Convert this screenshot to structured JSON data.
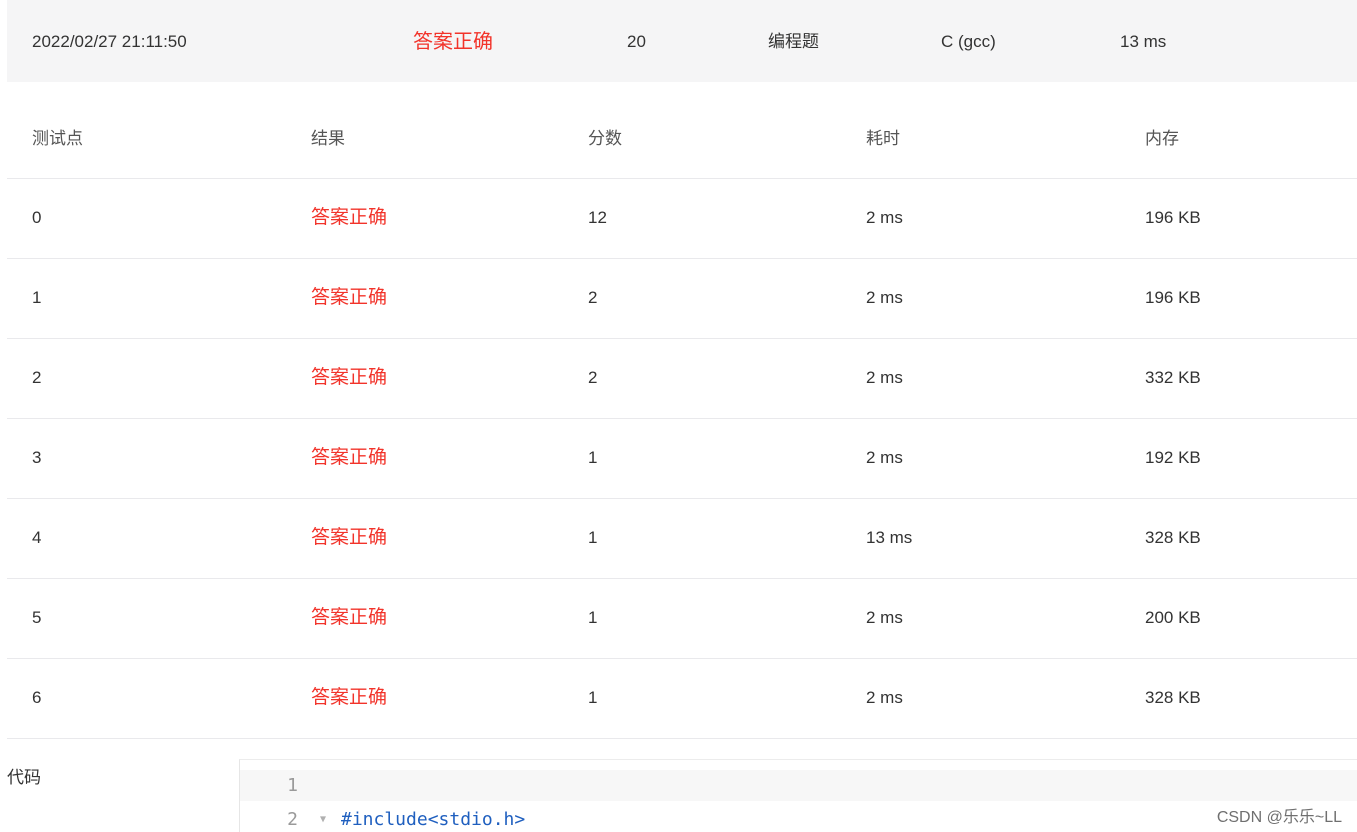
{
  "summary": {
    "time": "2022/02/27 21:11:50",
    "result": "答案正确",
    "score": "20",
    "type": "编程题",
    "language": "C (gcc)",
    "duration": "13 ms"
  },
  "table": {
    "headers": [
      "测试点",
      "结果",
      "分数",
      "耗时",
      "内存"
    ],
    "rows": [
      {
        "id": "0",
        "result": "答案正确",
        "score": "12",
        "time": "2 ms",
        "memory": "196 KB"
      },
      {
        "id": "1",
        "result": "答案正确",
        "score": "2",
        "time": "2 ms",
        "memory": "196 KB"
      },
      {
        "id": "2",
        "result": "答案正确",
        "score": "2",
        "time": "2 ms",
        "memory": "332 KB"
      },
      {
        "id": "3",
        "result": "答案正确",
        "score": "1",
        "time": "2 ms",
        "memory": "192 KB"
      },
      {
        "id": "4",
        "result": "答案正确",
        "score": "1",
        "time": "13 ms",
        "memory": "328 KB"
      },
      {
        "id": "5",
        "result": "答案正确",
        "score": "1",
        "time": "2 ms",
        "memory": "200 KB"
      },
      {
        "id": "6",
        "result": "答案正确",
        "score": "1",
        "time": "2 ms",
        "memory": "328 KB"
      }
    ]
  },
  "code": {
    "label": "代码",
    "lines": [
      {
        "number": "1",
        "text": ""
      },
      {
        "number": "2",
        "text": "#include<stdio.h>"
      }
    ]
  },
  "watermark": "CSDN @乐乐~LL",
  "colors": {
    "accent_red": "#f2332a",
    "summary_bg": "#f5f5f6",
    "code_keyword": "#1f5fbf"
  }
}
